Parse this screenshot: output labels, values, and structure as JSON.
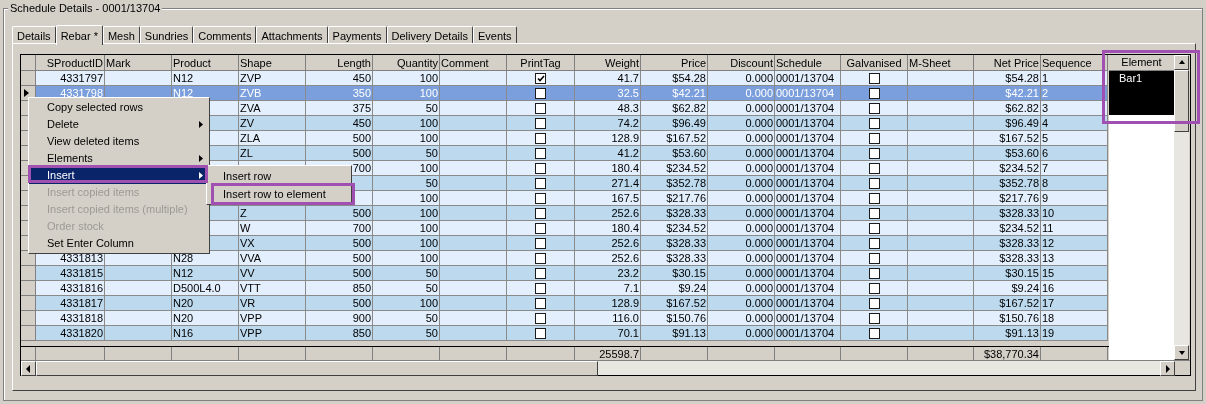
{
  "group_title": "Schedule Details - 0001/13704",
  "tabs": [
    {
      "label": "Details",
      "selected": false
    },
    {
      "label": "Rebar *",
      "selected": true
    },
    {
      "label": "Mesh",
      "selected": false
    },
    {
      "label": "Sundries",
      "selected": false
    },
    {
      "label": "Comments",
      "selected": false
    },
    {
      "label": "Attachments",
      "selected": false
    },
    {
      "label": "Payments",
      "selected": false
    },
    {
      "label": "Delivery Details",
      "selected": false
    },
    {
      "label": "Events",
      "selected": false
    }
  ],
  "table": {
    "columns": [
      "SProductID",
      "Mark",
      "Product",
      "Shape",
      "Length",
      "Quantity",
      "Comment",
      "PrintTag",
      "Weight",
      "Price",
      "Discount",
      "Schedule",
      "Galvanised",
      "M-Sheet",
      "Net Price",
      "Sequence"
    ],
    "rows": [
      {
        "selected": false,
        "sproductid": "4331797",
        "product": "N12",
        "shape": "ZVP",
        "length": "450",
        "quantity": "100",
        "print_tag": true,
        "weight": "41.7",
        "price": "$54.28",
        "discount": "0.000",
        "schedule": "0001/13704",
        "galvanised": false,
        "net_price": "$54.28",
        "sequence": "1"
      },
      {
        "selected": true,
        "sproductid": "4331798",
        "product": "N12",
        "shape": "ZVB",
        "length": "350",
        "quantity": "100",
        "print_tag": false,
        "weight": "32.5",
        "price": "$42.21",
        "discount": "0.000",
        "schedule": "0001/13704",
        "galvanised": false,
        "net_price": "$42.21",
        "sequence": "2"
      },
      {
        "selected": false,
        "shape": "ZVA",
        "length": "375",
        "quantity": "50",
        "print_tag": false,
        "weight": "48.3",
        "price": "$62.82",
        "discount": "0.000",
        "schedule": "0001/13704",
        "galvanised": false,
        "net_price": "$62.82",
        "sequence": "3"
      },
      {
        "selected": false,
        "shape": "ZV",
        "length": "450",
        "quantity": "100",
        "print_tag": false,
        "weight": "74.2",
        "price": "$96.49",
        "discount": "0.000",
        "schedule": "0001/13704",
        "galvanised": false,
        "net_price": "$96.49",
        "sequence": "4"
      },
      {
        "selected": false,
        "shape": "ZLA",
        "length": "500",
        "quantity": "100",
        "print_tag": false,
        "weight": "128.9",
        "price": "$167.52",
        "discount": "0.000",
        "schedule": "0001/13704",
        "galvanised": false,
        "net_price": "$167.52",
        "sequence": "5"
      },
      {
        "selected": false,
        "shape": "ZL",
        "length": "500",
        "quantity": "50",
        "print_tag": false,
        "weight": "41.2",
        "price": "$53.60",
        "discount": "0.000",
        "schedule": "0001/13704",
        "galvanised": false,
        "net_price": "$53.60",
        "sequence": "6"
      },
      {
        "selected": false,
        "length": "700",
        "quantity": "100",
        "print_tag": false,
        "weight": "180.4",
        "price": "$234.52",
        "discount": "0.000",
        "schedule": "0001/13704",
        "galvanised": false,
        "net_price": "$234.52",
        "sequence": "7"
      },
      {
        "selected": false,
        "quantity": "50",
        "print_tag": false,
        "weight": "271.4",
        "price": "$352.78",
        "discount": "0.000",
        "schedule": "0001/13704",
        "galvanised": false,
        "net_price": "$352.78",
        "sequence": "8"
      },
      {
        "selected": false,
        "quantity": "100",
        "print_tag": false,
        "weight": "167.5",
        "price": "$217.76",
        "discount": "0.000",
        "schedule": "0001/13704",
        "galvanised": false,
        "net_price": "$217.76",
        "sequence": "9"
      },
      {
        "selected": false,
        "shape": "Z",
        "length": "500",
        "quantity": "100",
        "print_tag": false,
        "weight": "252.6",
        "price": "$328.33",
        "discount": "0.000",
        "schedule": "0001/13704",
        "galvanised": false,
        "net_price": "$328.33",
        "sequence": "10"
      },
      {
        "selected": false,
        "shape": "W",
        "length": "700",
        "quantity": "100",
        "print_tag": false,
        "weight": "180.4",
        "price": "$234.52",
        "discount": "0.000",
        "schedule": "0001/13704",
        "galvanised": false,
        "net_price": "$234.52",
        "sequence": "11"
      },
      {
        "selected": false,
        "shape": "VX",
        "length": "500",
        "quantity": "100",
        "print_tag": false,
        "weight": "252.6",
        "price": "$328.33",
        "discount": "0.000",
        "schedule": "0001/13704",
        "galvanised": false,
        "net_price": "$328.33",
        "sequence": "12"
      },
      {
        "selected": false,
        "sproductid": "4331813",
        "product": "N28",
        "shape": "VVA",
        "length": "500",
        "quantity": "100",
        "print_tag": false,
        "weight": "252.6",
        "price": "$328.33",
        "discount": "0.000",
        "schedule": "0001/13704",
        "galvanised": false,
        "net_price": "$328.33",
        "sequence": "13"
      },
      {
        "selected": false,
        "sproductid": "4331815",
        "product": "N12",
        "shape": "VV",
        "length": "500",
        "quantity": "50",
        "print_tag": false,
        "weight": "23.2",
        "price": "$30.15",
        "discount": "0.000",
        "schedule": "0001/13704",
        "galvanised": false,
        "net_price": "$30.15",
        "sequence": "15"
      },
      {
        "selected": false,
        "sproductid": "4331816",
        "product": "D500L4.0",
        "shape": "VTT",
        "length": "850",
        "quantity": "50",
        "print_tag": false,
        "weight": "7.1",
        "price": "$9.24",
        "discount": "0.000",
        "schedule": "0001/13704",
        "galvanised": false,
        "net_price": "$9.24",
        "sequence": "16"
      },
      {
        "selected": false,
        "sproductid": "4331817",
        "product": "N20",
        "shape": "VR",
        "length": "500",
        "quantity": "100",
        "print_tag": false,
        "weight": "128.9",
        "price": "$167.52",
        "discount": "0.000",
        "schedule": "0001/13704",
        "galvanised": false,
        "net_price": "$167.52",
        "sequence": "17"
      },
      {
        "selected": false,
        "sproductid": "4331818",
        "product": "N20",
        "shape": "VPP",
        "length": "900",
        "quantity": "50",
        "print_tag": false,
        "weight": "116.0",
        "price": "$150.76",
        "discount": "0.000",
        "schedule": "0001/13704",
        "galvanised": false,
        "net_price": "$150.76",
        "sequence": "18"
      },
      {
        "selected": false,
        "sproductid": "4331820",
        "product": "N16",
        "shape": "VPP",
        "length": "850",
        "quantity": "50",
        "print_tag": false,
        "weight": "70.1",
        "price": "$91.13",
        "discount": "0.000",
        "schedule": "0001/13704",
        "galvanised": false,
        "net_price": "$91.13",
        "sequence": "19"
      }
    ],
    "totals": {
      "weight": "25598.7",
      "net_price": "$38,770.34"
    }
  },
  "element_panel": {
    "heading": "Element",
    "items": [
      {
        "label": "Bar1",
        "selected": true
      }
    ]
  },
  "context_menu": {
    "items": [
      {
        "label": "Copy selected rows",
        "submenu": false,
        "disabled": false,
        "selected": false
      },
      {
        "label": "Delete",
        "submenu": true,
        "disabled": false,
        "selected": false
      },
      {
        "label": "View deleted items",
        "submenu": false,
        "disabled": false,
        "selected": false
      },
      {
        "label": "Elements",
        "submenu": true,
        "disabled": false,
        "selected": false
      },
      {
        "label": "Insert",
        "submenu": true,
        "disabled": false,
        "selected": true
      },
      {
        "label": "Insert copied items",
        "submenu": false,
        "disabled": true,
        "selected": false
      },
      {
        "label": "Insert copied items (multiple)",
        "submenu": false,
        "disabled": true,
        "selected": false
      },
      {
        "label": "Order stock",
        "submenu": false,
        "disabled": true,
        "selected": false
      },
      {
        "label": "Set Enter Column",
        "submenu": false,
        "disabled": false,
        "selected": false
      }
    ],
    "submenu": [
      {
        "label": "Insert row"
      },
      {
        "label": "Insert row to element"
      }
    ]
  }
}
